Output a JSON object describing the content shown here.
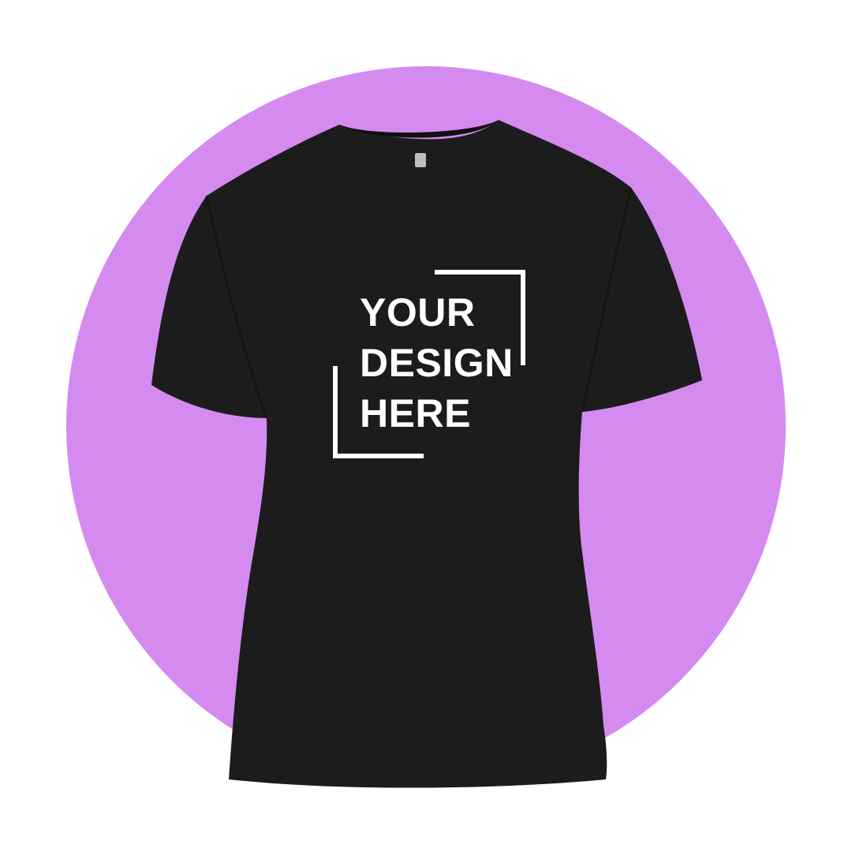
{
  "colors": {
    "background": "#ffffff",
    "circle": "#d58af0",
    "shirt": "#1c1c1c",
    "shirt_shadow": "#0f0f0f",
    "print": "#ffffff"
  },
  "print": {
    "lines": [
      "YOUR",
      "DESIGN",
      "HERE"
    ]
  },
  "icons": {
    "neck_label": "tag-icon",
    "frame_top_right": "corner-bracket-icon",
    "frame_bottom_left": "corner-bracket-icon"
  }
}
